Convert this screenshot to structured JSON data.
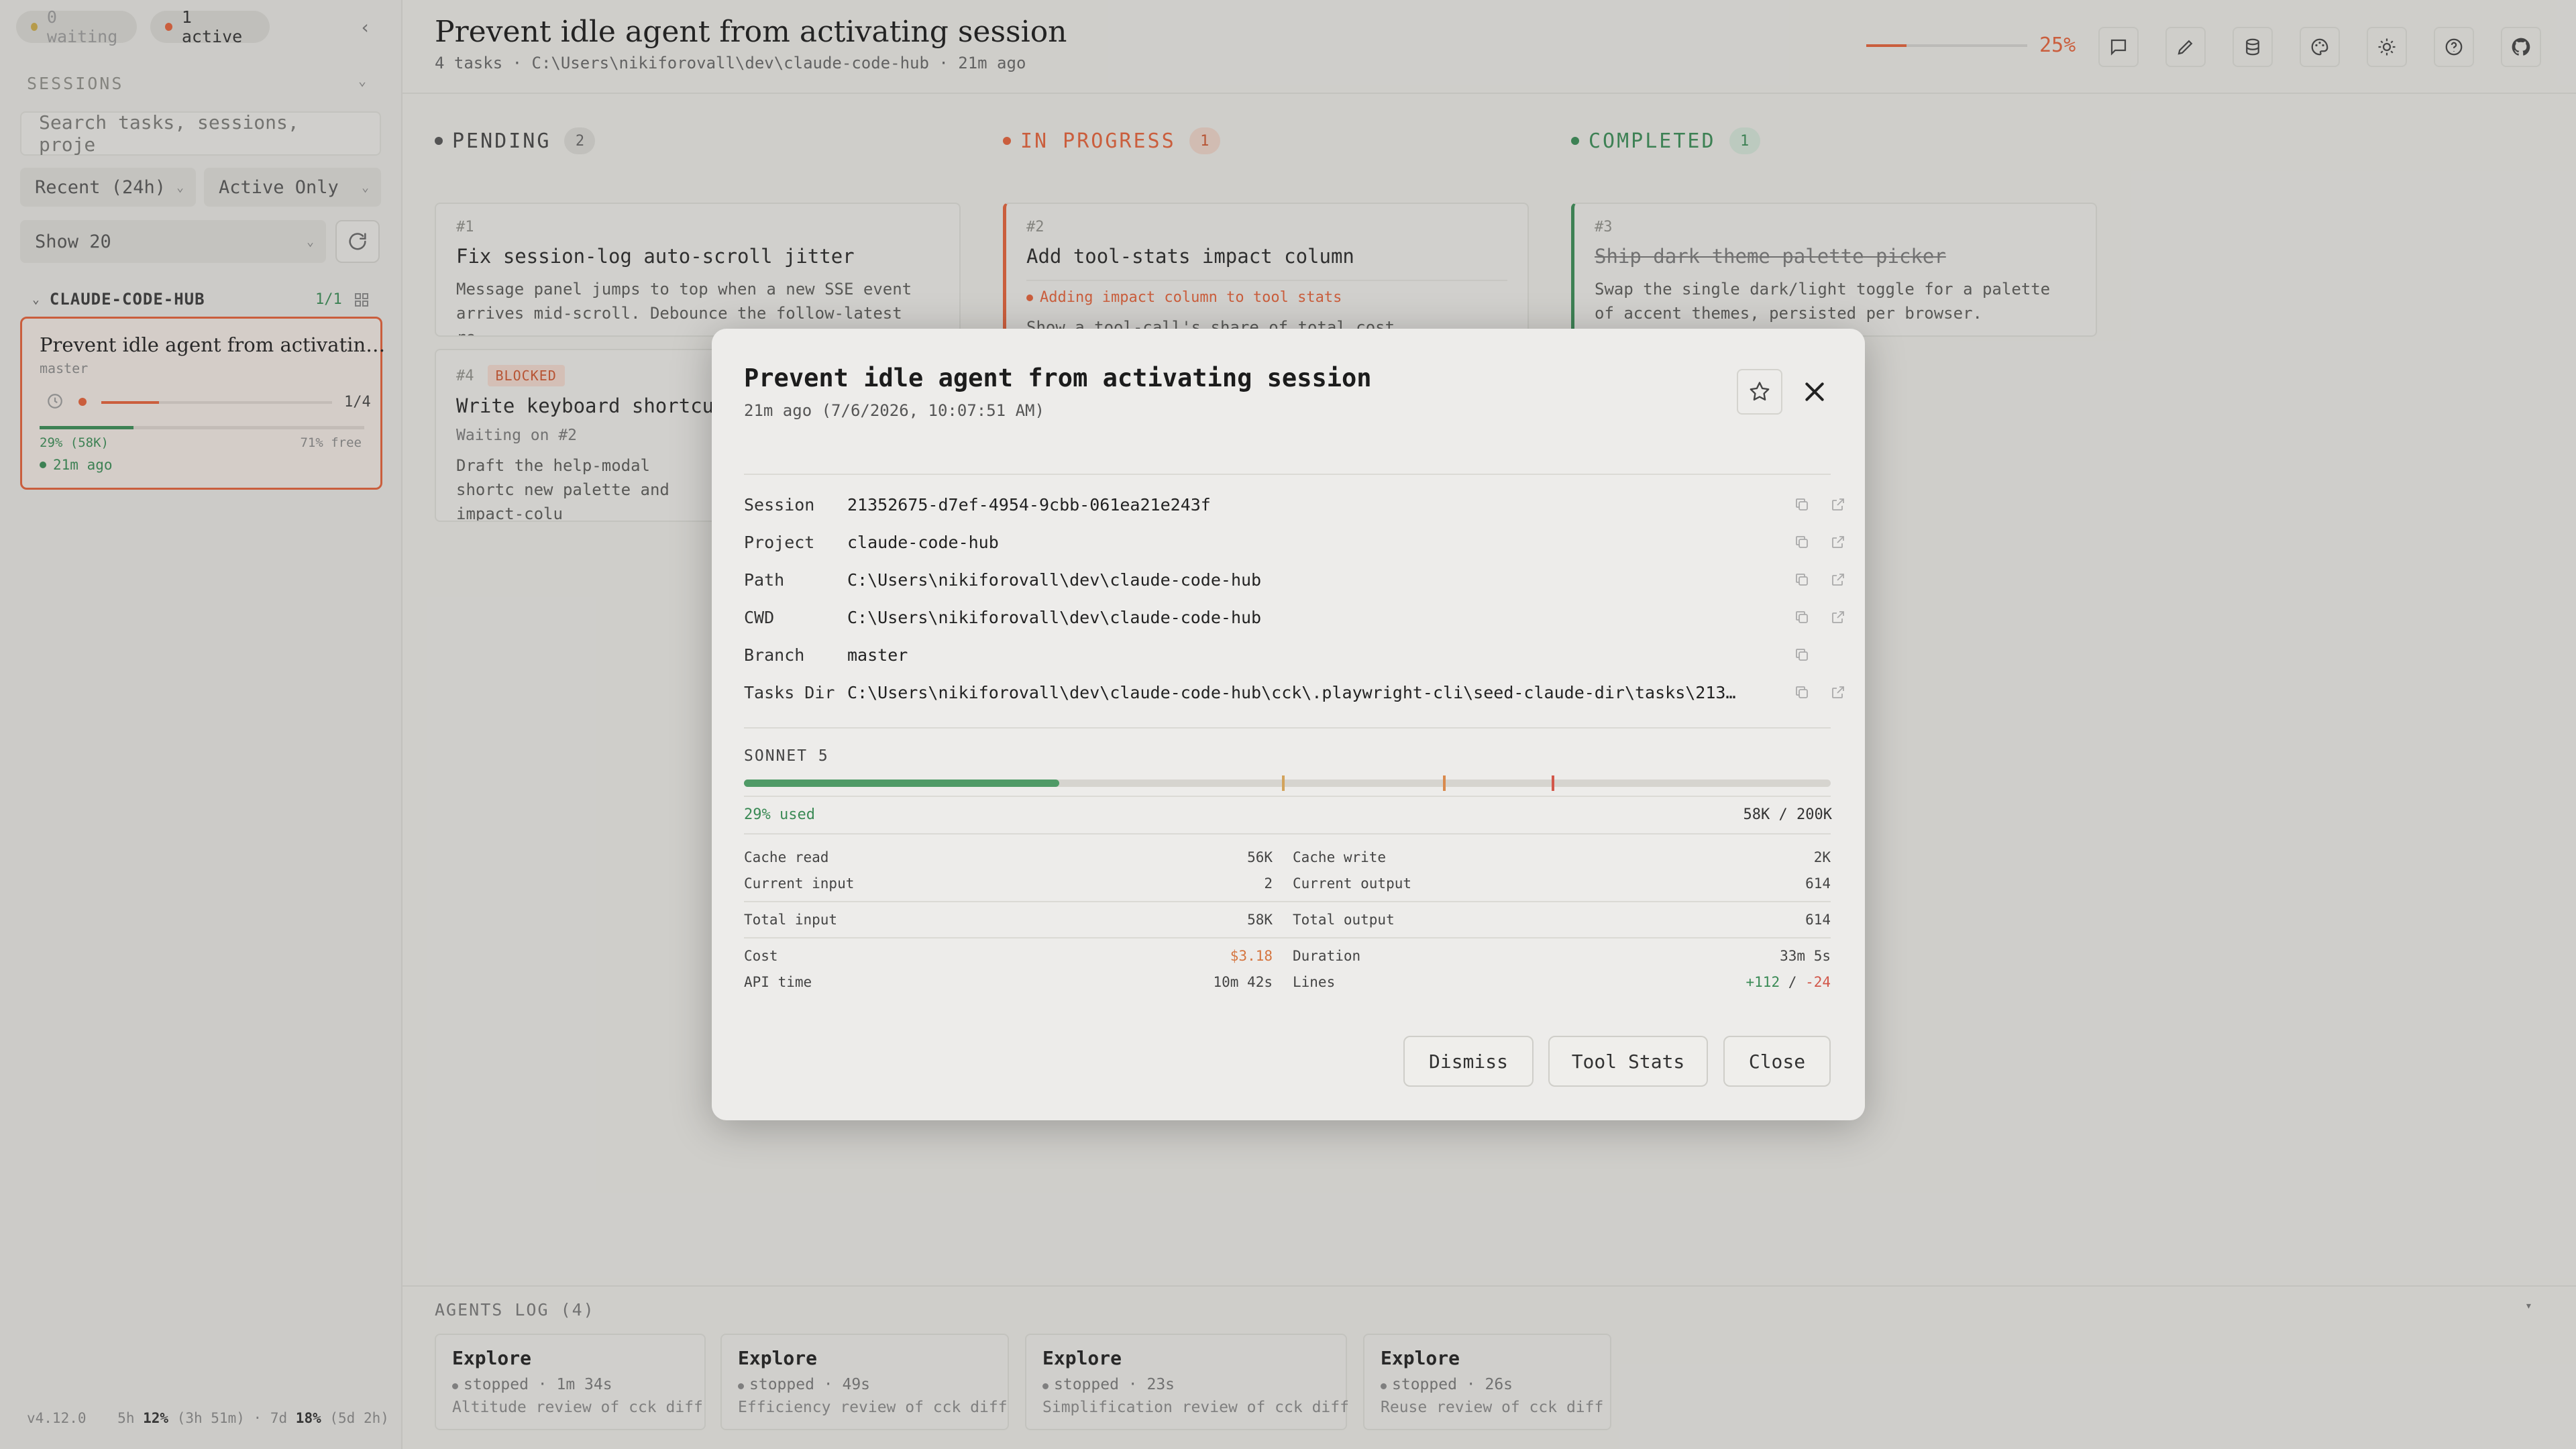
{
  "sidebar": {
    "waiting_label": "0 waiting",
    "active_label": "1 active",
    "sessions_label": "SESSIONS",
    "search_placeholder": "Search tasks, sessions, proje",
    "recent_select": "Recent (24h)",
    "active_select": "Active Only",
    "show_select": "Show 20",
    "group_name": "CLAUDE-CODE-HUB",
    "group_count": "1/1",
    "session_card": {
      "title": "Prevent idle agent from activatin…",
      "branch": "master",
      "progress_text": "1/4",
      "ctx_used": "29% (58K)",
      "ctx_free": "71% free",
      "time": "21m ago",
      "progress_fraction": 0.25,
      "ctx_fraction": 0.29
    },
    "footer": {
      "version": "v4.12.0",
      "prefix5h": "5h",
      "pct5h": "12%",
      "rem5h": "(3h 51m)",
      "sep": "·",
      "prefix7d": "7d",
      "pct7d": "18%",
      "rem7d": "(5d 2h)"
    }
  },
  "header": {
    "title": "Prevent idle agent from activating session",
    "subtitle": "4 tasks · C:\\Users\\nikiforovall\\dev\\claude-code-hub · 21m ago",
    "progress_pct": "25%",
    "progress_value": 0.25,
    "icons": [
      "message-icon",
      "edit-icon",
      "database-icon",
      "palette-icon",
      "sun-icon",
      "help-icon",
      "github-icon"
    ]
  },
  "columns": {
    "pending": {
      "label": "PENDING",
      "count": "2"
    },
    "in_progress": {
      "label": "IN PROGRESS",
      "count": "1"
    },
    "completed": {
      "label": "COMPLETED",
      "count": "1"
    }
  },
  "cards": {
    "c1": {
      "num": "#1",
      "title": "Fix session-log auto-scroll jitter",
      "desc": "Message panel jumps to top when a new SSE event arrives mid-scroll. Debounce the follow-latest re…"
    },
    "c4": {
      "num": "#4",
      "badge": "BLOCKED",
      "title": "Write keyboard shortcut d",
      "waiting": "Waiting on #2",
      "desc": "Draft the help-modal shortc new palette and impact-colu"
    },
    "c2": {
      "num": "#2",
      "title": "Add tool-stats impact column",
      "activity": "Adding impact column to tool stats",
      "desc": "Show a tool-call's share of total cost"
    },
    "c3": {
      "num": "#3",
      "title": "Ship dark theme palette picker",
      "desc": "Swap the single dark/light toggle for a palette of accent themes, persisted per browser."
    }
  },
  "modal": {
    "title": "Prevent idle agent from activating session",
    "subtitle": "21m ago (7/6/2026, 10:07:51 AM)",
    "rows": [
      {
        "key": "Session",
        "value": "21352675-d7ef-4954-9cbb-061ea21e243f"
      },
      {
        "key": "Project",
        "value": "claude-code-hub"
      },
      {
        "key": "Path",
        "value": "C:\\Users\\nikiforovall\\dev\\claude-code-hub"
      },
      {
        "key": "CWD",
        "value": "C:\\Users\\nikiforovall\\dev\\claude-code-hub"
      },
      {
        "key": "Branch",
        "value": "master"
      },
      {
        "key": "Tasks Dir",
        "value": "C:\\Users\\nikiforovall\\dev\\claude-code-hub\\cck\\.playwright-cli\\seed-claude-dir\\tasks\\2135267…"
      }
    ],
    "model": "SONNET 5",
    "context_fraction": 0.29,
    "used_label": "29% used",
    "tokens_label": "58K / 200K",
    "stats": {
      "cache_read": {
        "label": "Cache read",
        "value": "56K"
      },
      "cache_write": {
        "label": "Cache write",
        "value": "2K"
      },
      "current_input": {
        "label": "Current input",
        "value": "2"
      },
      "current_output": {
        "label": "Current output",
        "value": "614"
      },
      "total_input": {
        "label": "Total input",
        "value": "58K"
      },
      "total_output": {
        "label": "Total output",
        "value": "614"
      },
      "cost": {
        "label": "Cost",
        "value": "$3.18"
      },
      "duration": {
        "label": "Duration",
        "value": "33m 5s"
      },
      "api_time": {
        "label": "API time",
        "value": "10m 42s"
      },
      "lines": {
        "label": "Lines",
        "added": "+112",
        "sep": "/",
        "removed": "-24"
      }
    },
    "buttons": {
      "dismiss": "Dismiss",
      "tool_stats": "Tool Stats",
      "close": "Close"
    }
  },
  "agents_log": {
    "title": "AGENTS LOG (4)",
    "agents": [
      {
        "name": "Explore",
        "status": "stopped · 1m 34s",
        "desc": "Altitude review of cck diff"
      },
      {
        "name": "Explore",
        "status": "stopped · 49s",
        "desc": "Efficiency review of cck diff"
      },
      {
        "name": "Explore",
        "status": "stopped · 23s",
        "desc": "Simplification review of cck diff"
      },
      {
        "name": "Explore",
        "status": "stopped · 26s",
        "desc": "Reuse review of cck diff"
      }
    ]
  },
  "colors": {
    "accent": "#e0613a",
    "green": "#3a8a55",
    "pending": "#555555"
  }
}
